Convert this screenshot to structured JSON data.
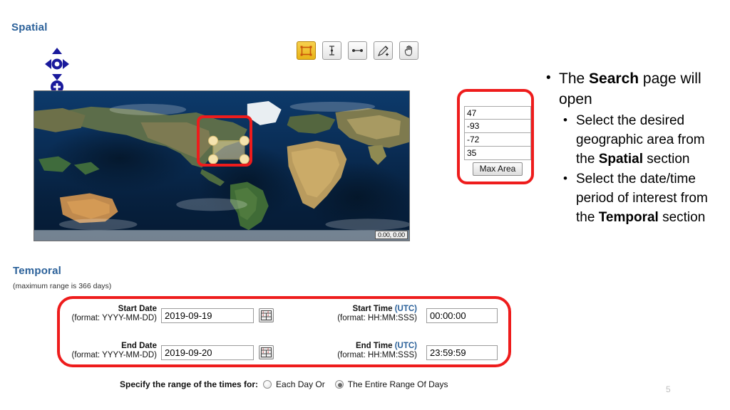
{
  "spatial": {
    "heading": "Spatial",
    "nav": {
      "pan_icon": "pan-four-arrows-icon",
      "zoom_in_icon": "zoom-in-plus-icon",
      "globe_icon": "globe-icon",
      "zoom_out_icon": "zoom-out-minus-icon"
    },
    "toolbar": [
      {
        "name": "rectangle-select-tool",
        "icon": "rectangle-select-icon",
        "active": true
      },
      {
        "name": "vertical-line-tool",
        "icon": "vertical-line-icon",
        "active": false
      },
      {
        "name": "horizontal-line-tool",
        "icon": "horizontal-line-icon",
        "active": false
      },
      {
        "name": "draw-polygon-tool",
        "icon": "pencil-plus-icon",
        "active": false
      },
      {
        "name": "pan-hand-tool",
        "icon": "hand-icon",
        "active": false
      }
    ],
    "map": {
      "coord_readout": "0.00, 0.00",
      "selection_label": "map-bbox-selection"
    },
    "coords": {
      "north": "47",
      "west": "-93",
      "east": "-72",
      "south": "35",
      "max_area_label": "Max Area"
    }
  },
  "temporal": {
    "heading": "Temporal",
    "subnote": "(maximum range is 366 days)",
    "fields": {
      "start_date": {
        "title": "Start Date",
        "format": "(format: YYYY-MM-DD)",
        "value": "2019-09-19",
        "calendar_icon": "calendar-icon"
      },
      "end_date": {
        "title": "End Date",
        "format": "(format: YYYY-MM-DD)",
        "value": "2019-09-20",
        "calendar_icon": "calendar-icon"
      },
      "start_time": {
        "title": "Start Time",
        "tz": "(UTC)",
        "format": "(format: HH:MM:SSS)",
        "value": "00:00:00"
      },
      "end_time": {
        "title": "End Time",
        "tz": "(UTC)",
        "format": "(format: HH:MM:SSS)",
        "value": "23:59:59"
      }
    },
    "range_mode": {
      "lead": "Specify the range of the times for:",
      "option_each_day": "Each Day Or",
      "option_entire_range": "The Entire Range Of Days",
      "selected": "entire_range"
    }
  },
  "notes": {
    "b1_pre": "The ",
    "b1_bold": "Search",
    "b1_post": " page will open",
    "b2_pre": "Select the desired geographic area from the ",
    "b2_bold": "Spatial",
    "b2_post": " section",
    "b3_pre": "Select the date/time period of interest from the ",
    "b3_bold": "Temporal",
    "b3_post": " section"
  },
  "page_number": "5",
  "colors": {
    "heading_blue": "#2a6099",
    "annotation_red": "#ee1c1c",
    "active_tool": "#e8b317"
  }
}
